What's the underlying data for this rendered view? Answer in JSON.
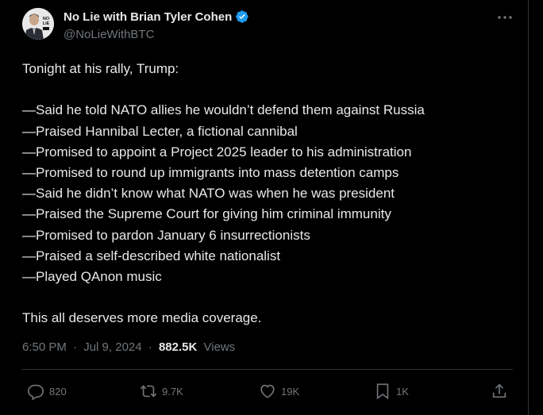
{
  "author": {
    "name": "No Lie with Brian Tyler Cohen",
    "handle": "@NoLieWithBTC",
    "avatar_badge_text": "NO LIE"
  },
  "tweet": {
    "intro": "Tonight at his rally, Trump:",
    "items": [
      "—Said he told NATO allies he wouldn’t defend them against Russia",
      "—Praised Hannibal Lecter, a fictional cannibal",
      "—Promised to appoint a Project 2025 leader to his administration",
      "—Promised to round up immigrants into mass detention camps",
      "—Said he didn’t know what NATO was when he was president",
      "—Praised the Supreme Court for giving him criminal immunity",
      "—Promised to pardon January 6 insurrectionists",
      "—Praised a self-described white nationalist",
      "—Played QAnon music"
    ],
    "closing": "This all deserves more media coverage."
  },
  "meta": {
    "time": "6:50 PM",
    "separator1": "·",
    "date": "Jul 9, 2024",
    "separator2": "·",
    "views_count": "882.5K",
    "views_label": "Views"
  },
  "actions": {
    "replies": "820",
    "reposts": "9.7K",
    "likes": "19K",
    "bookmarks": "1K"
  },
  "icons": {
    "verified": "verified-badge-icon",
    "more": "more-horizontal-icon",
    "reply": "reply-icon",
    "repost": "repost-icon",
    "like": "heart-icon",
    "bookmark": "bookmark-icon",
    "share": "share-icon"
  },
  "colors": {
    "background": "#000000",
    "text": "#e7e9ea",
    "secondary": "#71767b",
    "verified": "#1d9bf0",
    "divider": "#2f3336"
  }
}
